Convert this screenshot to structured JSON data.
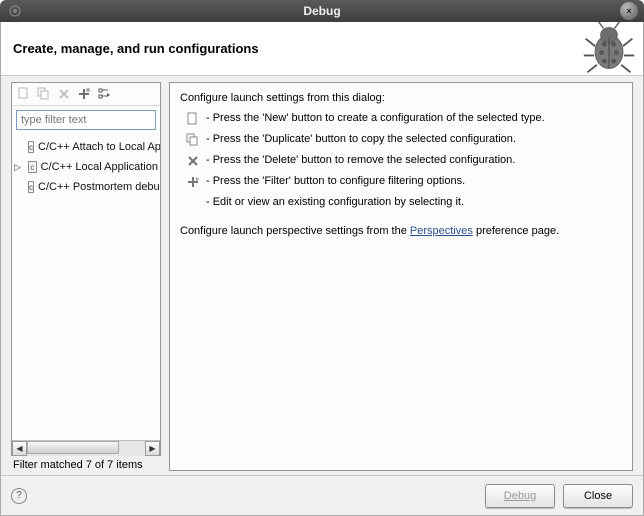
{
  "titlebar": {
    "title": "Debug",
    "close_glyph": "×"
  },
  "header": {
    "title": "Create, manage, and run configurations"
  },
  "sidebar": {
    "filter_placeholder": "type filter text",
    "tree": [
      {
        "label": "C/C++ Attach to Local Application",
        "expanded": false,
        "has_arrow": false
      },
      {
        "label": "C/C++ Local Application",
        "expanded": false,
        "has_arrow": true
      },
      {
        "label": "C/C++ Postmortem debugger",
        "expanded": false,
        "has_arrow": false
      }
    ],
    "filterline": "Filter matched 7 of 7 items"
  },
  "right": {
    "intro": "Configure launch settings from this dialog:",
    "steps": [
      {
        "icon": "new-icon",
        "text": "- Press the 'New' button to create a configuration of the selected type."
      },
      {
        "icon": "duplicate-icon",
        "text": "- Press the 'Duplicate' button to copy the selected configuration."
      },
      {
        "icon": "delete-icon",
        "text": "- Press the 'Delete' button to remove the selected configuration."
      },
      {
        "icon": "filter-icon",
        "text": "- Press the 'Filter' button to configure filtering options."
      },
      {
        "icon": "",
        "text": "- Edit or view an existing configuration by selecting it."
      }
    ],
    "perspective_prefix": "Configure launch perspective settings from the ",
    "perspective_link": "Perspectives",
    "perspective_suffix": " preference page."
  },
  "footer": {
    "debug_label": "Debug",
    "close_label": "Close",
    "help_glyph": "?"
  },
  "icons": {
    "eclipse": "◉",
    "scroll_left": "◀",
    "scroll_right": "▶"
  }
}
